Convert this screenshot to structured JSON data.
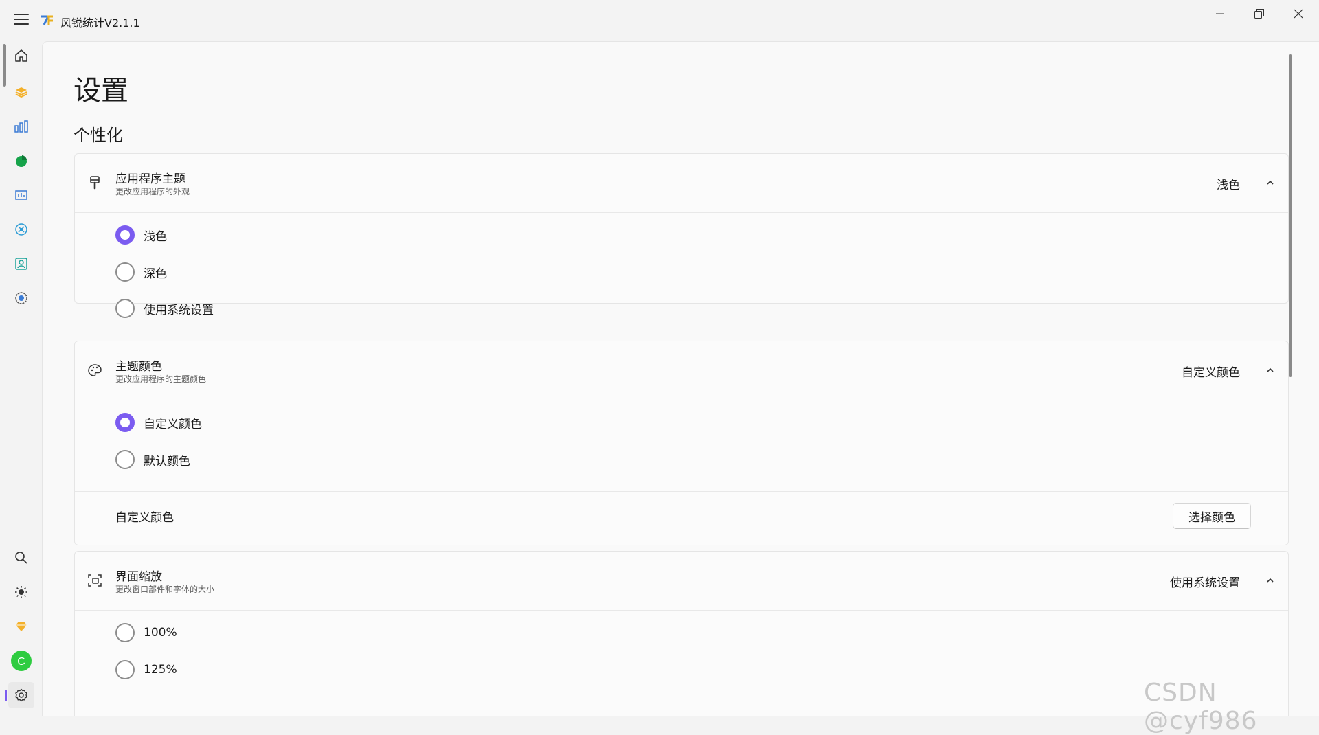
{
  "app": {
    "title": "风锐统计V2.1.1"
  },
  "page": {
    "title": "设置",
    "section": "个性化"
  },
  "cards": {
    "theme": {
      "title": "应用程序主题",
      "subtitle": "更改应用程序的外观",
      "value": "浅色",
      "options": [
        "浅色",
        "深色",
        "使用系统设置"
      ],
      "selected": "浅色"
    },
    "color": {
      "title": "主题颜色",
      "subtitle": "更改应用程序的主题颜色",
      "value": "自定义颜色",
      "options": [
        "自定义颜色",
        "默认颜色"
      ],
      "selected": "自定义颜色",
      "custom_label": "自定义颜色",
      "button_label": "选择颜色"
    },
    "scale": {
      "title": "界面缩放",
      "subtitle": "更改窗口部件和字体的大小",
      "value": "使用系统设置",
      "options": [
        "100%",
        "125%"
      ]
    }
  },
  "nav": {
    "top": [
      "home-icon",
      "layers-icon",
      "bar-chart-icon",
      "pie-chart-icon",
      "dashboard-icon",
      "network-icon",
      "report-icon",
      "globe-icon"
    ],
    "bottom": [
      "search-icon",
      "brightness-icon",
      "diamond-icon",
      "avatar",
      "settings-icon"
    ],
    "avatar_letter": "C"
  },
  "colors": {
    "accent": "#7b5cf0",
    "avatar": "#2ecc40"
  },
  "watermark": "CSDN @cyf986"
}
